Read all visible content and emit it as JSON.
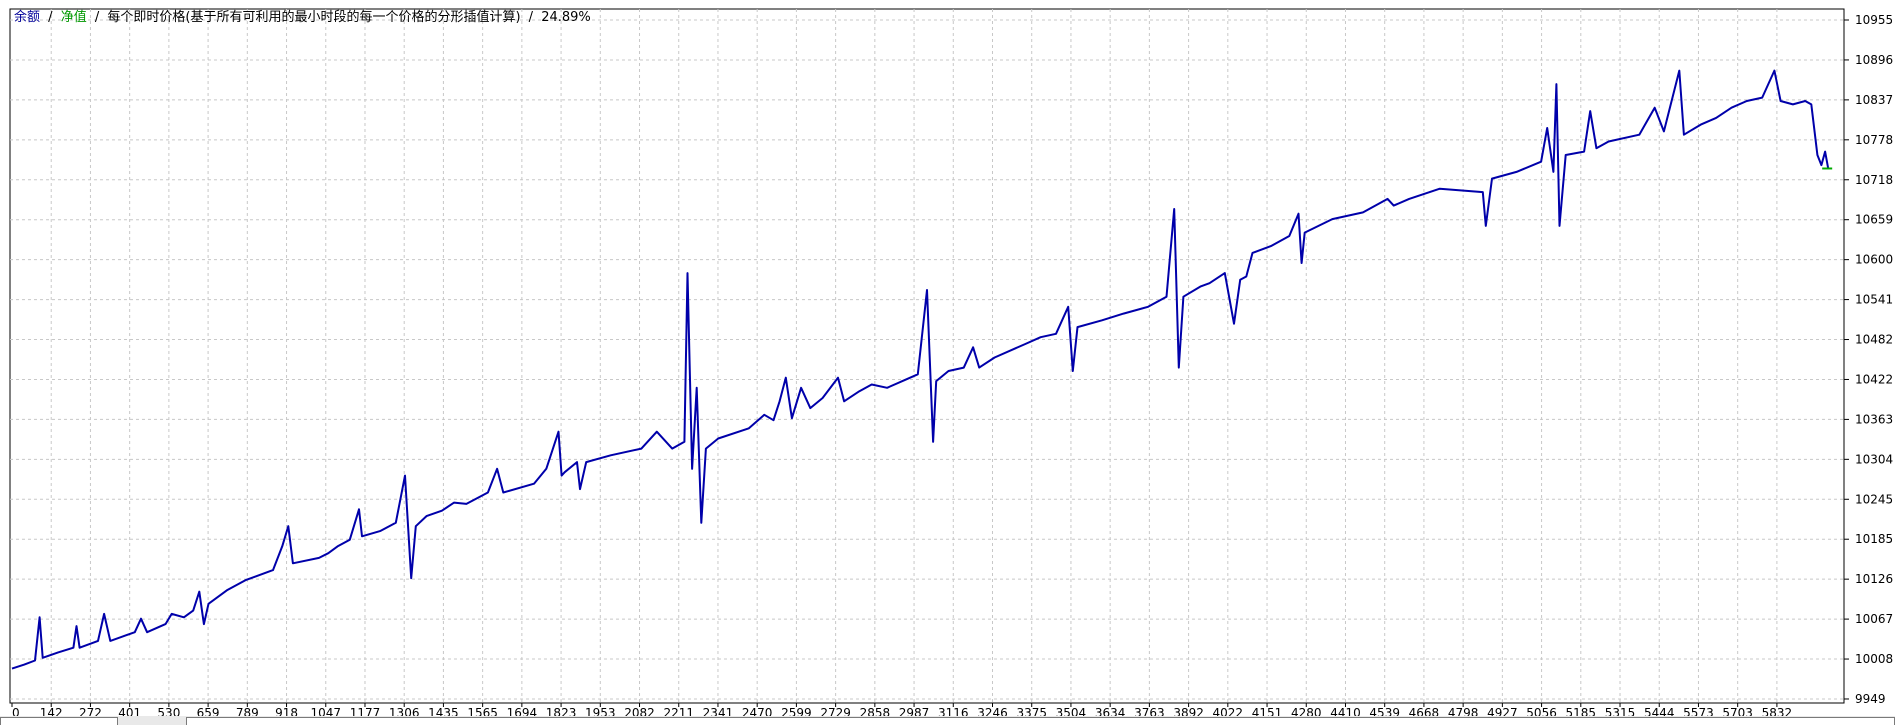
{
  "legend": {
    "balance_label": "余额",
    "equity_label": "净值",
    "separator": "/",
    "description": "每个即时价格(基于所有可利用的最小时段的每一个价格的分形插值计算)",
    "percent": "24.89%",
    "balance_color": "#000099",
    "equity_color": "#009900"
  },
  "colors": {
    "line": "#0000aa",
    "last_marker": "#00aa00",
    "grid": "#c8c8c8",
    "axis": "#000000"
  },
  "chart_data": {
    "type": "line",
    "x_tick_labels": [
      "0",
      "142",
      "272",
      "401",
      "530",
      "659",
      "789",
      "918",
      "1047",
      "1177",
      "1306",
      "1435",
      "1565",
      "1694",
      "1823",
      "1953",
      "2082",
      "2211",
      "2341",
      "2470",
      "2599",
      "2729",
      "2858",
      "2987",
      "3116",
      "3246",
      "3375",
      "3504",
      "3634",
      "3763",
      "3892",
      "4022",
      "4151",
      "4280",
      "4410",
      "4539",
      "4668",
      "4798",
      "4927",
      "5056",
      "5185",
      "5315",
      "5444",
      "5573",
      "5703",
      "5832"
    ],
    "y_tick_labels": [
      "10955",
      "10896",
      "10837",
      "10778",
      "10718",
      "10659",
      "10600",
      "10541",
      "10482",
      "10422",
      "10363",
      "10304",
      "10245",
      "10185",
      "10126",
      "10067",
      "10008",
      "9949"
    ],
    "xlim": [
      0,
      5960
    ],
    "ylim": [
      9949,
      10955
    ],
    "grid": true,
    "series": [
      {
        "points": [
          [
            0,
            9994
          ],
          [
            40,
            10000
          ],
          [
            75,
            10006
          ],
          [
            90,
            10070
          ],
          [
            100,
            10010
          ],
          [
            150,
            10018
          ],
          [
            200,
            10025
          ],
          [
            210,
            10057
          ],
          [
            220,
            10025
          ],
          [
            280,
            10035
          ],
          [
            300,
            10075
          ],
          [
            320,
            10035
          ],
          [
            400,
            10048
          ],
          [
            420,
            10068
          ],
          [
            440,
            10048
          ],
          [
            500,
            10060
          ],
          [
            520,
            10075
          ],
          [
            560,
            10070
          ],
          [
            590,
            10080
          ],
          [
            610,
            10108
          ],
          [
            625,
            10060
          ],
          [
            640,
            10090
          ],
          [
            700,
            10110
          ],
          [
            760,
            10125
          ],
          [
            850,
            10140
          ],
          [
            880,
            10175
          ],
          [
            900,
            10205
          ],
          [
            915,
            10150
          ],
          [
            1000,
            10158
          ],
          [
            1030,
            10165
          ],
          [
            1060,
            10175
          ],
          [
            1100,
            10185
          ],
          [
            1130,
            10230
          ],
          [
            1140,
            10190
          ],
          [
            1200,
            10198
          ],
          [
            1250,
            10210
          ],
          [
            1280,
            10280
          ],
          [
            1300,
            10128
          ],
          [
            1315,
            10205
          ],
          [
            1350,
            10220
          ],
          [
            1400,
            10228
          ],
          [
            1440,
            10240
          ],
          [
            1480,
            10238
          ],
          [
            1550,
            10255
          ],
          [
            1580,
            10290
          ],
          [
            1600,
            10255
          ],
          [
            1700,
            10268
          ],
          [
            1740,
            10290
          ],
          [
            1780,
            10345
          ],
          [
            1790,
            10280
          ],
          [
            1800,
            10285
          ],
          [
            1840,
            10300
          ],
          [
            1850,
            10260
          ],
          [
            1870,
            10300
          ],
          [
            1950,
            10310
          ],
          [
            2050,
            10320
          ],
          [
            2100,
            10345
          ],
          [
            2150,
            10320
          ],
          [
            2190,
            10330
          ],
          [
            2200,
            10580
          ],
          [
            2215,
            10290
          ],
          [
            2230,
            10410
          ],
          [
            2245,
            10210
          ],
          [
            2260,
            10320
          ],
          [
            2300,
            10335
          ],
          [
            2400,
            10350
          ],
          [
            2450,
            10370
          ],
          [
            2480,
            10362
          ],
          [
            2500,
            10390
          ],
          [
            2520,
            10425
          ],
          [
            2540,
            10365
          ],
          [
            2570,
            10410
          ],
          [
            2600,
            10380
          ],
          [
            2640,
            10395
          ],
          [
            2690,
            10425
          ],
          [
            2710,
            10390
          ],
          [
            2760,
            10405
          ],
          [
            2800,
            10415
          ],
          [
            2850,
            10410
          ],
          [
            2900,
            10420
          ],
          [
            2950,
            10430
          ],
          [
            2980,
            10555
          ],
          [
            3000,
            10330
          ],
          [
            3010,
            10420
          ],
          [
            3050,
            10435
          ],
          [
            3100,
            10440
          ],
          [
            3130,
            10470
          ],
          [
            3150,
            10440
          ],
          [
            3200,
            10455
          ],
          [
            3300,
            10475
          ],
          [
            3350,
            10485
          ],
          [
            3400,
            10490
          ],
          [
            3440,
            10530
          ],
          [
            3455,
            10435
          ],
          [
            3470,
            10500
          ],
          [
            3550,
            10510
          ],
          [
            3620,
            10520
          ],
          [
            3700,
            10530
          ],
          [
            3760,
            10545
          ],
          [
            3785,
            10675
          ],
          [
            3800,
            10440
          ],
          [
            3815,
            10545
          ],
          [
            3870,
            10560
          ],
          [
            3900,
            10565
          ],
          [
            3950,
            10580
          ],
          [
            3980,
            10505
          ],
          [
            4000,
            10570
          ],
          [
            4020,
            10575
          ],
          [
            4040,
            10610
          ],
          [
            4100,
            10620
          ],
          [
            4160,
            10635
          ],
          [
            4190,
            10668
          ],
          [
            4200,
            10595
          ],
          [
            4210,
            10640
          ],
          [
            4300,
            10660
          ],
          [
            4400,
            10670
          ],
          [
            4480,
            10690
          ],
          [
            4500,
            10680
          ],
          [
            4550,
            10690
          ],
          [
            4650,
            10705
          ],
          [
            4790,
            10700
          ],
          [
            4800,
            10650
          ],
          [
            4820,
            10720
          ],
          [
            4900,
            10730
          ],
          [
            4980,
            10745
          ],
          [
            5000,
            10795
          ],
          [
            5020,
            10730
          ],
          [
            5030,
            10860
          ],
          [
            5040,
            10650
          ],
          [
            5060,
            10755
          ],
          [
            5120,
            10760
          ],
          [
            5140,
            10820
          ],
          [
            5160,
            10765
          ],
          [
            5200,
            10775
          ],
          [
            5300,
            10785
          ],
          [
            5350,
            10825
          ],
          [
            5380,
            10790
          ],
          [
            5430,
            10880
          ],
          [
            5445,
            10785
          ],
          [
            5500,
            10800
          ],
          [
            5550,
            10810
          ],
          [
            5600,
            10825
          ],
          [
            5650,
            10835
          ],
          [
            5700,
            10840
          ],
          [
            5740,
            10880
          ],
          [
            5760,
            10835
          ],
          [
            5800,
            10830
          ],
          [
            5840,
            10835
          ],
          [
            5860,
            10830
          ],
          [
            5880,
            10755
          ],
          [
            5893,
            10740
          ],
          [
            5905,
            10760
          ],
          [
            5915,
            10735
          ]
        ]
      }
    ],
    "last_point": [
      5915,
      10735
    ]
  }
}
